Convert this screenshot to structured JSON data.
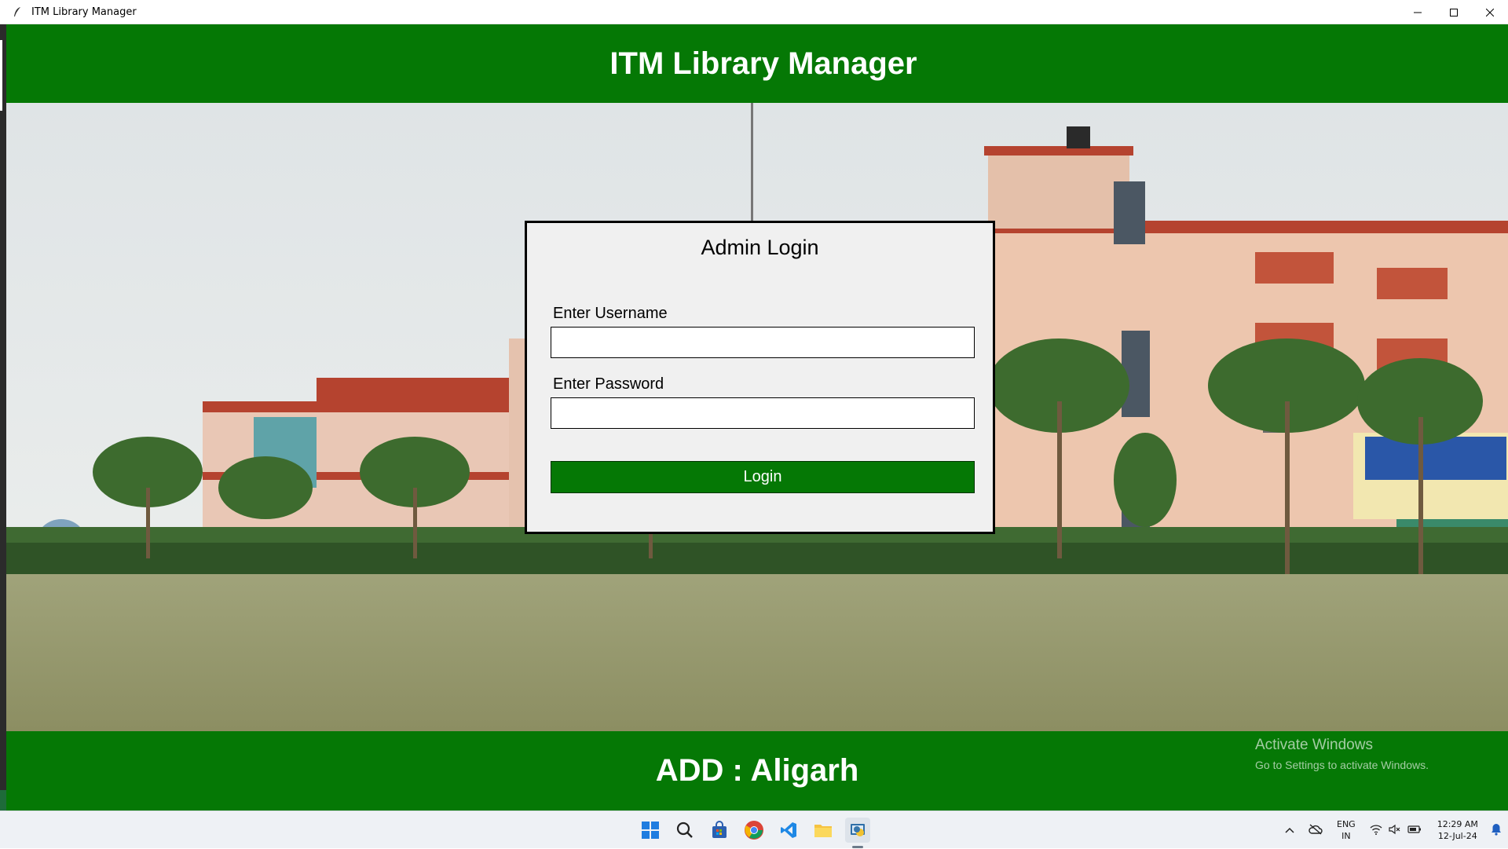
{
  "window": {
    "title": "ITM Library Manager",
    "controls": [
      "minimize",
      "maximize",
      "close"
    ]
  },
  "header": {
    "title": "ITM Library Manager"
  },
  "login": {
    "heading": "Admin Login",
    "username_label": "Enter Username",
    "username_value": "",
    "password_label": "Enter Password",
    "password_value": "",
    "button_label": "Login"
  },
  "footer": {
    "address": "ADD : Aligarh"
  },
  "watermark": {
    "line1": "Activate Windows",
    "line2": "Go to Settings to activate Windows."
  },
  "taskbar": {
    "icons": [
      "windows-start-icon",
      "search-icon",
      "store-icon",
      "chrome-icon",
      "vscode-icon",
      "file-explorer-icon",
      "python-app-icon"
    ],
    "language_line1": "ENG",
    "language_line2": "IN",
    "time": "12:29 AM",
    "date": "12-Jul-24"
  },
  "colors": {
    "brand_green": "#057805",
    "dialog_bg": "#f0f0f0"
  }
}
